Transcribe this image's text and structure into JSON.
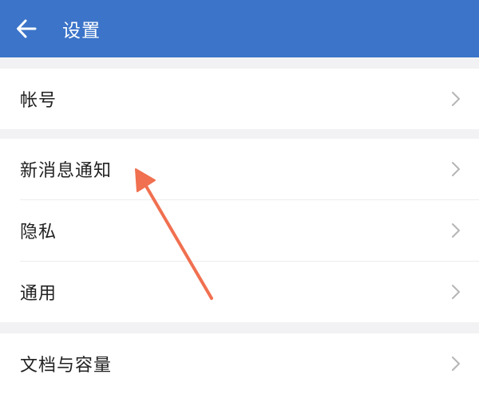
{
  "app_bar": {
    "title": "设置",
    "back_icon": "arrow-left-icon",
    "background": "#3b74c9"
  },
  "groups": [
    {
      "items": [
        {
          "label": "帐号"
        }
      ]
    },
    {
      "items": [
        {
          "label": "新消息通知"
        },
        {
          "label": "隐私"
        },
        {
          "label": "通用"
        }
      ]
    },
    {
      "items": [
        {
          "label": "文档与容量"
        }
      ]
    }
  ],
  "annotation": {
    "type": "arrow",
    "color": "#f07050",
    "points_to": "新消息通知"
  }
}
